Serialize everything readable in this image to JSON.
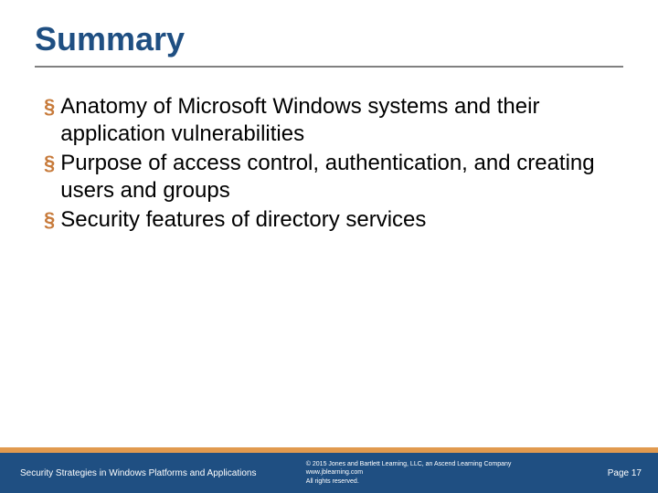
{
  "title": "Summary",
  "bullets": [
    "Anatomy of Microsoft Windows systems and their application vulnerabilities",
    "Purpose of access control, authentication, and creating users and groups",
    "Security features of directory services"
  ],
  "footer": {
    "left": "Security Strategies in Windows Platforms and Applications",
    "copyright_line1": "© 2015 Jones and Bartlett Learning, LLC, an Ascend Learning Company",
    "copyright_line2": "www.jblearning.com",
    "copyright_line3": "All rights reserved.",
    "page_label": "Page 17"
  },
  "colors": {
    "title": "#1f4f82",
    "bullet_marker": "#c77a3a",
    "footer_bg": "#1f4f82",
    "accent_strip": "#e19a4f"
  }
}
